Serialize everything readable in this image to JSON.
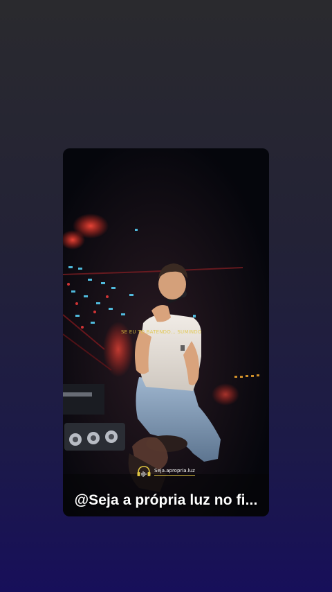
{
  "story": {
    "overlay_text": "SE EU TO BATENDO... SUMINDO",
    "watermark_handle": "Seja.apropria.luz",
    "caption": "@Seja a própria luz no fi..."
  },
  "icons": {
    "watermark_logo": "headphones-soundwave-icon"
  },
  "colors": {
    "background_top": "#2a2a2e",
    "background_bottom": "#170f5a",
    "accent_gold": "#e0c542",
    "caption_text": "#ffffff"
  }
}
